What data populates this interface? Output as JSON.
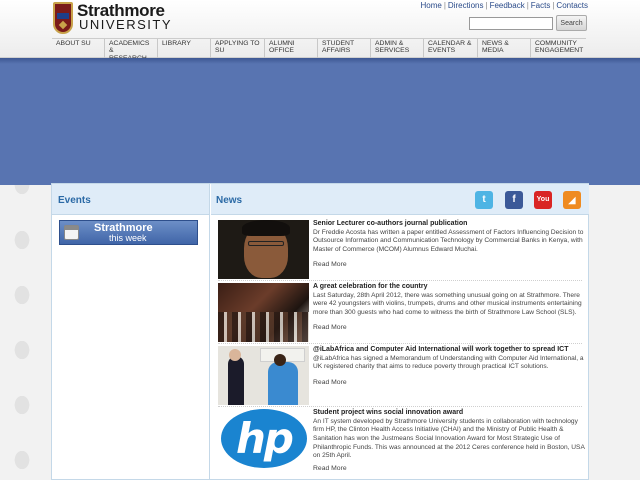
{
  "header": {
    "logo_top": "Strathmore",
    "logo_bottom": "UNIVERSITY",
    "toplinks": [
      "Home",
      "Directions",
      "Feedback",
      "Facts",
      "Contacts"
    ],
    "search_button": "Search"
  },
  "nav": [
    {
      "line1": "About SU",
      "line2": ""
    },
    {
      "line1": "Academics &",
      "line2": "Research"
    },
    {
      "line1": "Library",
      "line2": ""
    },
    {
      "line1": "Applying to",
      "line2": "SU"
    },
    {
      "line1": "Alumni",
      "line2": "Office"
    },
    {
      "line1": "Student",
      "line2": "Affairs"
    },
    {
      "line1": "Admin &",
      "line2": "Services"
    },
    {
      "line1": "Calendar &",
      "line2": "Events"
    },
    {
      "line1": "News &",
      "line2": "Media"
    },
    {
      "line1": "Community",
      "line2": "Engagement"
    }
  ],
  "events": {
    "heading": "Events",
    "week_line1": "Strathmore",
    "week_line2": "this week"
  },
  "news": {
    "heading": "News",
    "social": {
      "twitter": "t",
      "facebook": "f",
      "youtube": "You",
      "rss": "◢"
    },
    "items": [
      {
        "title": "Senior Lecturer co-authors journal publication",
        "body": "Dr Freddie Acosta has written a paper entitled Assessment of Factors Influencing Decision to Outsource Information and Communication Technology by Commercial Banks in Kenya, with Master of Commerce (MCOM) Alumnus Edward Muchai.",
        "read_more": "Read More"
      },
      {
        "title": "A great celebration for the country",
        "body": "Last Saturday, 28th April 2012, there was something unusual going on at Strathmore. There were 42 youngsters with violins, trumpets, drums and other musical instruments entertaining more than 300 guests who had come to witness the birth of Strathmore Law School (SLS).",
        "read_more": "Read More"
      },
      {
        "title": "@iLabAfrica and Computer Aid International will work together to spread ICT",
        "body": "@iLabAfrica has signed a Memorandum of Understanding with Computer Aid International, a UK registered charity that aims to reduce poverty through practical ICT solutions.",
        "read_more": "Read More"
      },
      {
        "title": "Student project wins social innovation award",
        "body": "An IT system developed by Strathmore University students in collaboration with technology firm HP, the Clinton Health Access Initiative (CHAI) and the Ministry of Public Health & Sanitation has won the Justmeans Social Innovation Award for Most Strategic Use of Philanthropic Funds. This was announced at the 2012 Ceres conference held in Boston, USA on 25th April.",
        "read_more": "Read More",
        "logo_text": "hp"
      }
    ]
  },
  "colors": {
    "banner": "#5874b1",
    "heading": "#2b6aa6",
    "panel_head": "#dfecf8"
  }
}
